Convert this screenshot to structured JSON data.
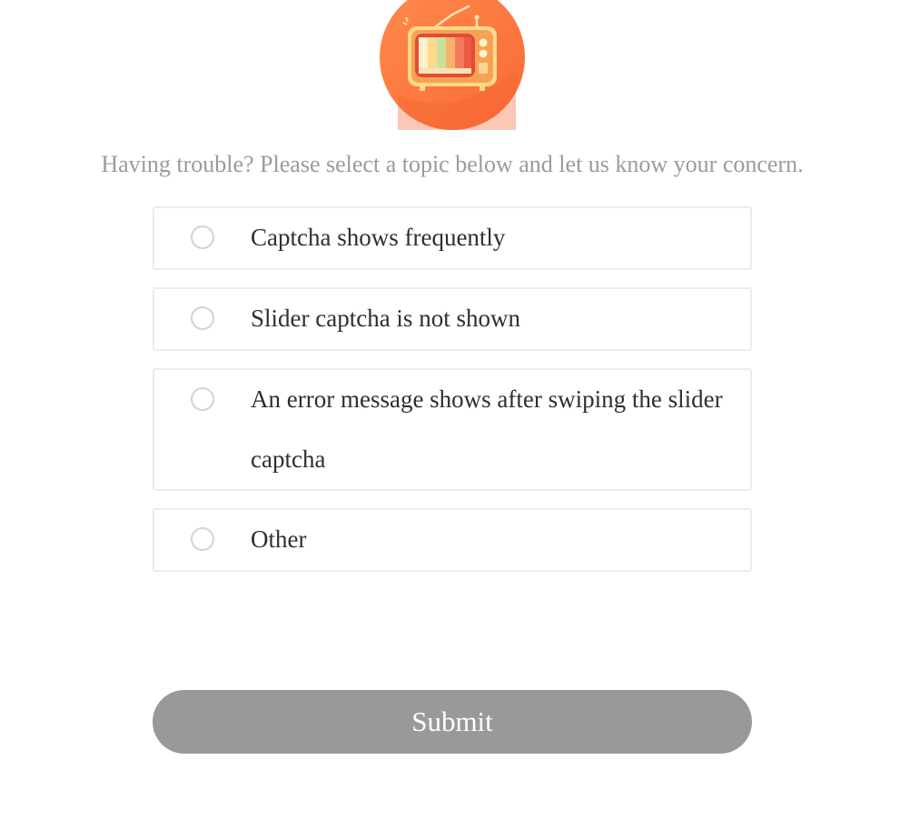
{
  "illustration": {
    "icon": "retro-tv-icon",
    "background_color": "#ff7a3f"
  },
  "prompt": "Having trouble? Please select a topic below and let us know your concern.",
  "options": [
    {
      "label": "Captcha shows frequently",
      "selected": false
    },
    {
      "label": "Slider captcha is not shown",
      "selected": false
    },
    {
      "label": "An error message shows after swiping the slider captcha",
      "selected": false
    },
    {
      "label": "Other",
      "selected": false
    }
  ],
  "submit": {
    "label": "Submit",
    "color": "#999999"
  }
}
